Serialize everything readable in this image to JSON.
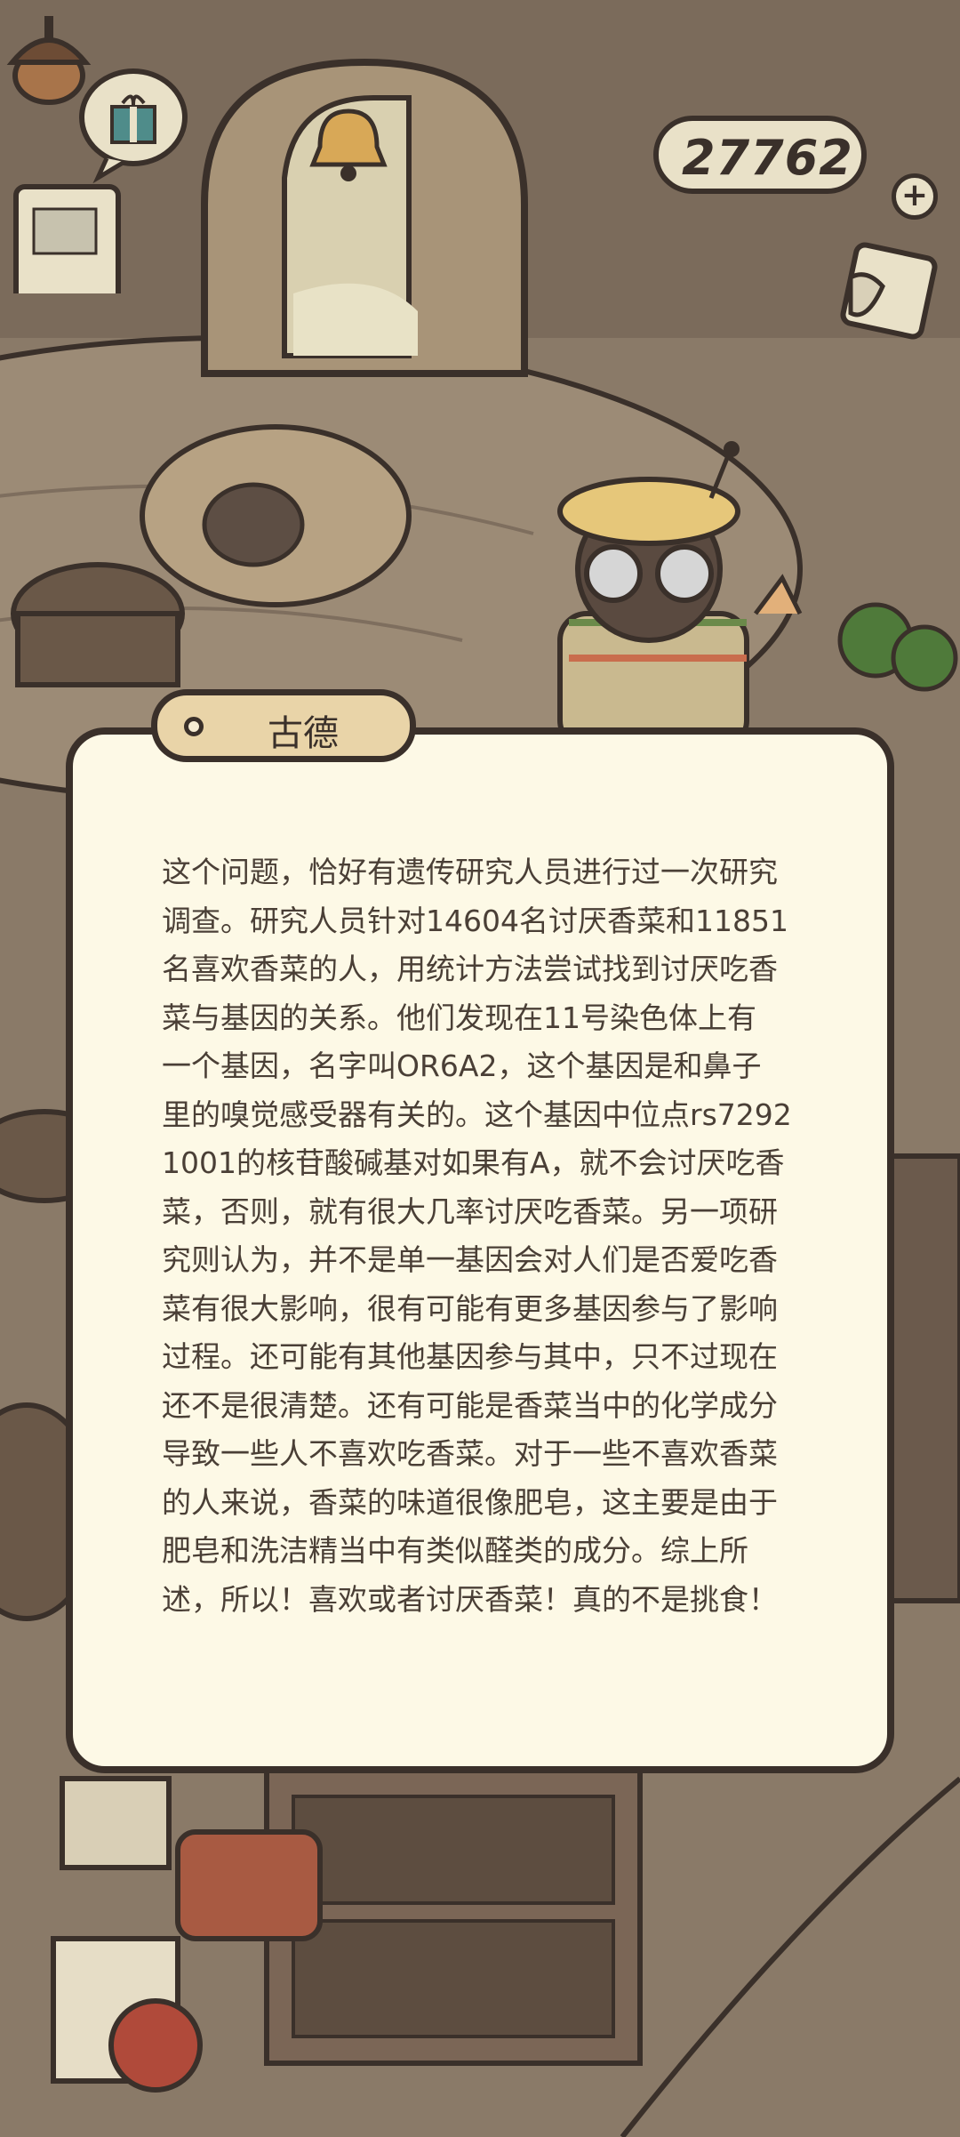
{
  "hud": {
    "coins": "27762",
    "add_label": "+"
  },
  "dialog": {
    "speaker": "古德",
    "text": "这个问题，恰好有遗传研究人员进行过一次研究\n调查。研究人员针对14604名讨厌香菜和11851\n名喜欢香菜的人，用统计方法尝试找到讨厌吃香\n菜与基因的关系。他们发现在11号染色体上有\n一个基因，名字叫OR6A2，这个基因是和鼻子\n里的嗅觉感受器有关的。这个基因中位点rs7292\n1001的核苷酸碱基对如果有A，就不会讨厌吃香\n菜，否则，就有很大几率讨厌吃香菜。另一项研\n究则认为，并不是单一基因会对人们是否爱吃香\n菜有很大影响，很有可能有更多基因参与了影响\n过程。还可能有其他基因参与其中，只不过现在\n还不是很清楚。还有可能是香菜当中的化学成分\n导致一些人不喜欢吃香菜。对于一些不喜欢香菜\n的人来说，香菜的味道很像肥皂，这主要是由于\n肥皂和洗洁精当中有类似醛类的成分。综上所\n述，所以！喜欢或者讨厌香菜！真的不是挑食！"
  },
  "icons": {
    "gift": "gift-icon",
    "acorn": "acorn-icon",
    "mail": "mail-icon",
    "bell": "bell-icon"
  },
  "colors": {
    "outline": "#3a302a",
    "panel": "#fdf9e6",
    "nametag": "#e9d4a8",
    "wood": "#7b6b5b"
  }
}
